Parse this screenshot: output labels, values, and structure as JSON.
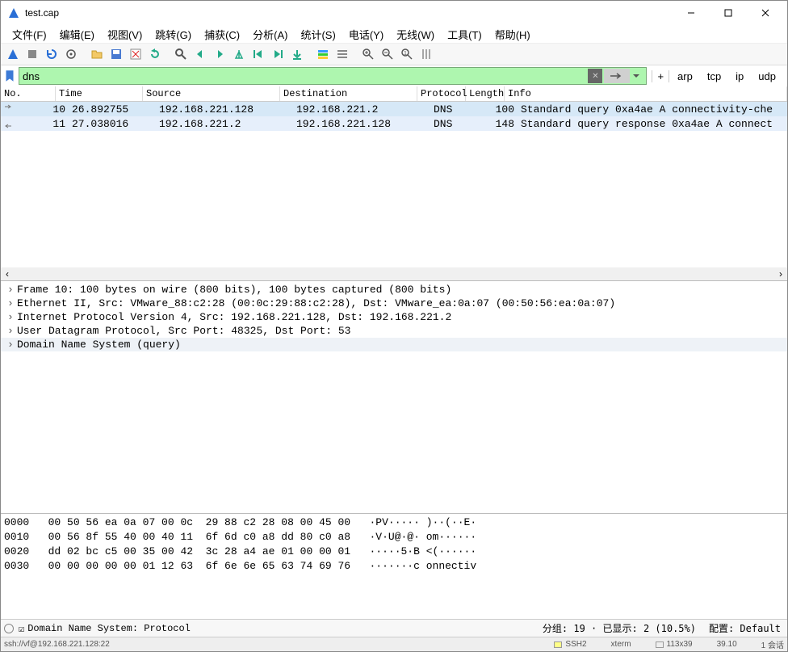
{
  "window": {
    "title": "test.cap"
  },
  "menu": {
    "file": "文件(F)",
    "edit": "编辑(E)",
    "view": "视图(V)",
    "go": "跳转(G)",
    "capture": "捕获(C)",
    "analyze": "分析(A)",
    "stats": "统计(S)",
    "telephony": "电话(Y)",
    "wireless": "无线(W)",
    "tools": "工具(T)",
    "help": "帮助(H)"
  },
  "filter": {
    "value": "dns",
    "plus": "+",
    "extra": [
      "arp",
      "tcp",
      "ip",
      "udp"
    ]
  },
  "columns": {
    "no": "No.",
    "time": "Time",
    "src": "Source",
    "dst": "Destination",
    "proto": "Protocol",
    "len": "Length",
    "info": "Info"
  },
  "rows": [
    {
      "no": "10",
      "time": "26.892755",
      "src": "192.168.221.128",
      "dst": "192.168.221.2",
      "proto": "DNS",
      "len": "100",
      "info": "Standard query 0xa4ae A connectivity-che"
    },
    {
      "no": "11",
      "time": "27.038016",
      "src": "192.168.221.2",
      "dst": "192.168.221.128",
      "proto": "DNS",
      "len": "148",
      "info": "Standard query response 0xa4ae A connect"
    }
  ],
  "details": [
    "Frame 10: 100 bytes on wire (800 bits), 100 bytes captured (800 bits)",
    "Ethernet II, Src: VMware_88:c2:28 (00:0c:29:88:c2:28), Dst: VMware_ea:0a:07 (00:50:56:ea:0a:07)",
    "Internet Protocol Version 4, Src: 192.168.221.128, Dst: 192.168.221.2",
    "User Datagram Protocol, Src Port: 48325, Dst Port: 53",
    "Domain Name System (query)"
  ],
  "hex": [
    {
      "off": "0000",
      "bytes": "00 50 56 ea 0a 07 00 0c  29 88 c2 28 08 00 45 00",
      "ascii": "·PV····· )··(··E·"
    },
    {
      "off": "0010",
      "bytes": "00 56 8f 55 40 00 40 11  6f 6d c0 a8 dd 80 c0 a8",
      "ascii": "·V·U@·@· om······"
    },
    {
      "off": "0020",
      "bytes": "dd 02 bc c5 00 35 00 42  3c 28 a4 ae 01 00 00 01",
      "ascii": "·····5·B <(······"
    },
    {
      "off": "0030",
      "bytes": "00 00 00 00 00 01 12 63  6f 6e 6e 65 63 74 69 76",
      "ascii": "·······c onnectiv"
    }
  ],
  "status": {
    "left_icon": "☑",
    "left": "Domain Name System: Protocol",
    "packets": "分组: 19 · 已显示: 2 (10.5%)",
    "profile": "配置: Default"
  },
  "bottom": {
    "ssh": "ssh://vf@192.168.221.128:22",
    "mode": "SSH2",
    "term": "xterm",
    "size": "113x39",
    "pos": "39.10",
    "sess": "1 会话"
  }
}
